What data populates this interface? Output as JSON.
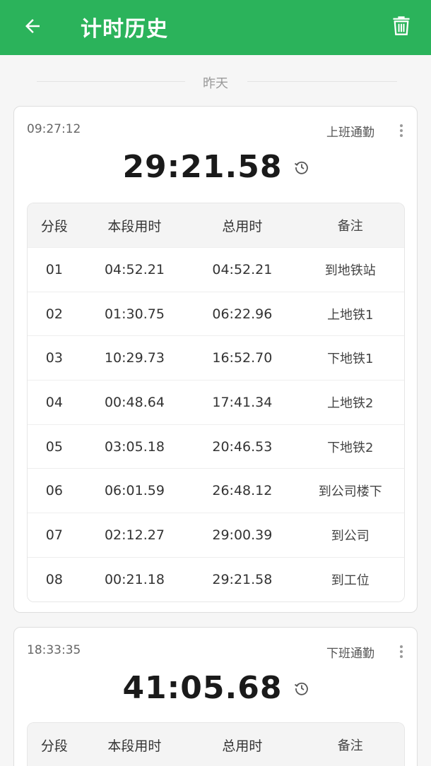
{
  "app_bar": {
    "title": "计时历史",
    "back_icon": "arrow-left-icon",
    "delete_icon": "trash-icon",
    "color": "#2bb35b"
  },
  "date_group": {
    "label": "昨天"
  },
  "table_headers": {
    "index": "分段",
    "segment": "本段用时",
    "total": "总用时",
    "note": "备注"
  },
  "records": [
    {
      "start_time": "09:27:12",
      "label": "上班通勤",
      "total_time": "29:21.58",
      "laps": [
        {
          "index": "01",
          "segment": "04:52.21",
          "total": "04:52.21",
          "note": "到地铁站"
        },
        {
          "index": "02",
          "segment": "01:30.75",
          "total": "06:22.96",
          "note": "上地铁1"
        },
        {
          "index": "03",
          "segment": "10:29.73",
          "total": "16:52.70",
          "note": "下地铁1"
        },
        {
          "index": "04",
          "segment": "00:48.64",
          "total": "17:41.34",
          "note": "上地铁2"
        },
        {
          "index": "05",
          "segment": "03:05.18",
          "total": "20:46.53",
          "note": "下地铁2"
        },
        {
          "index": "06",
          "segment": "06:01.59",
          "total": "26:48.12",
          "note": "到公司楼下"
        },
        {
          "index": "07",
          "segment": "02:12.27",
          "total": "29:00.39",
          "note": "到公司"
        },
        {
          "index": "08",
          "segment": "00:21.18",
          "total": "29:21.58",
          "note": "到工位"
        }
      ]
    },
    {
      "start_time": "18:33:35",
      "label": "下班通勤",
      "total_time": "41:05.68",
      "laps": []
    }
  ]
}
